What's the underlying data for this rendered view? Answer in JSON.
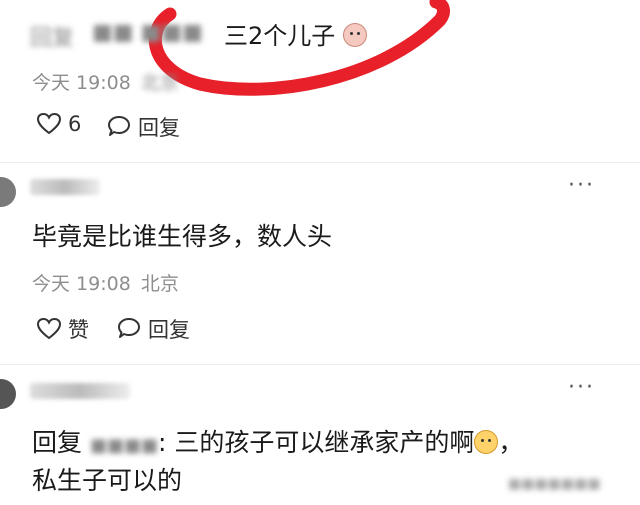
{
  "comment1": {
    "reply_prefix": "回复",
    "reply_target_blur": "■■ ■■■",
    "text_tail": "三2个儿子",
    "time": "今天 19:08",
    "location_blur": "北京",
    "like_count": "6",
    "reply_label": "回复"
  },
  "comment2": {
    "username_blur": "■■■■",
    "more": "···",
    "text": "毕竟是比谁生得多，数人头",
    "time": "今天 19:08",
    "location": "北京",
    "like_label": "赞",
    "reply_label": "回复"
  },
  "comment3": {
    "username_blur": "■■■■■",
    "more": "···",
    "reply_prefix": "回复",
    "reply_target_blur": "■■■■",
    "text_line1": ": 三的孩子可以继承家产的啊",
    "text_comma": "，",
    "text_line2": "私生子可以的"
  },
  "watermark": "■■■■■■■",
  "colors": {
    "annotation_red": "#e8202a",
    "meta_gray": "#8e8e8e"
  }
}
